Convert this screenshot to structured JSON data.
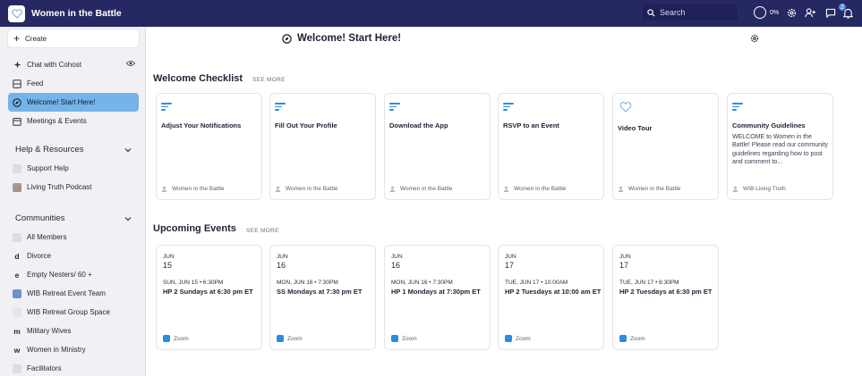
{
  "app": {
    "title": "Women in the Battle"
  },
  "topbar": {
    "search_placeholder": "Search",
    "progress": "0%",
    "notification_count": "2"
  },
  "sidebar": {
    "create_label": "Create",
    "top_items": [
      {
        "label": "Chat with Cohost"
      },
      {
        "label": "Feed"
      },
      {
        "label": "Welcome! Start Here!"
      },
      {
        "label": "Meetings & Events"
      }
    ],
    "help_title": "Help & Resources",
    "help_items": [
      {
        "label": "Support Help"
      },
      {
        "label": "Living Truth Podcast"
      }
    ],
    "communities_title": "Communities",
    "community_items": [
      {
        "label": "All Members"
      },
      {
        "label": "Divorce",
        "initial": "d"
      },
      {
        "label": "Empty Nesters/ 60 +",
        "initial": "e"
      },
      {
        "label": "WIB Retreat Event Team"
      },
      {
        "label": "WIB Retreat Group Space"
      },
      {
        "label": "Military Wives",
        "initial": "m"
      },
      {
        "label": "Women in Ministry",
        "initial": "w"
      },
      {
        "label": "Facilitators"
      }
    ]
  },
  "main": {
    "page_title": "Welcome! Start Here!",
    "checklist": {
      "title": "Welcome Checklist",
      "see_more": "SEE MORE",
      "cards": [
        {
          "title": "Adjust Your Notifications",
          "author": "Women in the Battle"
        },
        {
          "title": "Fill Out Your Profile",
          "author": "Women in the Battle"
        },
        {
          "title": "Download the App",
          "author": "Women in the Battle"
        },
        {
          "title": "RSVP to an Event",
          "author": "Women in the Battle"
        },
        {
          "title": "Video Tour",
          "author": "Women in the Battle"
        },
        {
          "title": "Community Guidelines",
          "desc": "WELCOME to Women in the Battle!  Please read our community guidelines regarding how to post and comment to...",
          "author": "WIB Living Truth"
        }
      ]
    },
    "events": {
      "title": "Upcoming Events",
      "see_more": "SEE MORE",
      "items": [
        {
          "month": "JUN",
          "day": "15",
          "when": "SUN, JUN 15 • 6:30PM",
          "title": "HP 2 Sundays at 6:30 pm ET",
          "location": "Zoom"
        },
        {
          "month": "JUN",
          "day": "16",
          "when": "MON, JUN 16 • 7:30PM",
          "title": "SS Mondays at 7:30 pm ET",
          "location": "Zoom"
        },
        {
          "month": "JUN",
          "day": "16",
          "when": "MON, JUN 16 • 7:30PM",
          "title": "HP 1 Mondays at 7:30pm ET",
          "location": "Zoom"
        },
        {
          "month": "JUN",
          "day": "17",
          "when": "TUE, JUN 17 • 10:00AM",
          "title": "HP 2 Tuesdays at 10:00 am ET",
          "location": "Zoom"
        },
        {
          "month": "JUN",
          "day": "17",
          "when": "TUE, JUN 17 • 6:30PM",
          "title": "HP 2 Tuesdays at 6:30 pm ET",
          "location": "Zoom"
        }
      ]
    }
  },
  "colors": {
    "topbar": "#262861",
    "active": "#74b4e8",
    "accent": "#2d8be0"
  }
}
